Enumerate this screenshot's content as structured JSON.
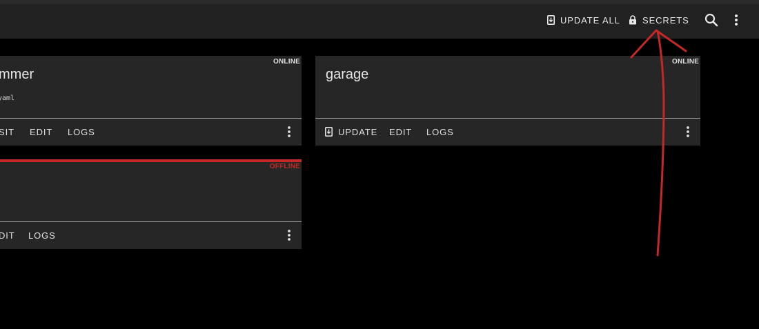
{
  "toolbar": {
    "update_all_label": "UPDATE ALL",
    "secrets_label": "SECRETS",
    "icons": {
      "update_all": "update-icon",
      "secrets": "lock-icon",
      "search": "search-icon",
      "more": "more-vert-icon"
    }
  },
  "cards": [
    {
      "title": "mmer",
      "subtitle": "yaml",
      "status": "ONLINE",
      "actions": [
        "SIT",
        "EDIT",
        "LOGS"
      ]
    },
    {
      "title": "garage",
      "status": "ONLINE",
      "actions": [
        "UPDATE",
        "EDIT",
        "LOGS"
      ]
    },
    {
      "title": "",
      "status": "OFFLINE",
      "actions": [
        "DIT",
        "LOGS"
      ]
    }
  ],
  "colors": {
    "background": "#000000",
    "appbar": "#212121",
    "card": "#262626",
    "online": "#e0e0e0",
    "offline": "#c62828",
    "annotation": "#c62828"
  }
}
